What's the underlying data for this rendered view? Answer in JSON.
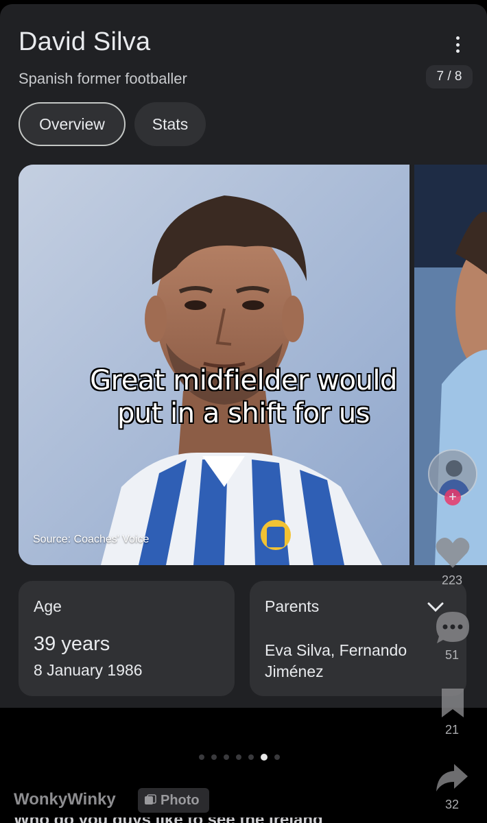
{
  "knowledge_panel": {
    "title": "David Silva",
    "subtitle": "Spanish former footballer",
    "image_counter": "7 / 8",
    "tabs": [
      {
        "label": "Overview",
        "selected": true
      },
      {
        "label": "Stats",
        "selected": false
      }
    ],
    "image_source": "Source: Coaches' Voice",
    "age": {
      "label": "Age",
      "value": "39 years",
      "date": "8 January 1986"
    },
    "parents": {
      "label": "Parents",
      "value": "Eva Silva, Fernando Jiménez"
    }
  },
  "caption": {
    "line1": "Great midfielder would",
    "line2": "put in a shift for us"
  },
  "carousel": {
    "total_dots": 7,
    "active_index": 5
  },
  "post": {
    "author": "WonkyWinky",
    "badge_label": "Photo",
    "description_partial": "Who do you guys like to see the Ireland"
  },
  "side_actions": {
    "likes": "223",
    "comments": "51",
    "saves": "21",
    "shares": "32"
  },
  "colors": {
    "panel_bg": "#202124",
    "card_bg": "#303134",
    "like_accent": "#e83a6b"
  },
  "icons": [
    "more-vert-icon",
    "chevron-down-icon",
    "heart-icon",
    "comment-icon",
    "bookmark-icon",
    "share-icon",
    "photo-badge-icon"
  ]
}
